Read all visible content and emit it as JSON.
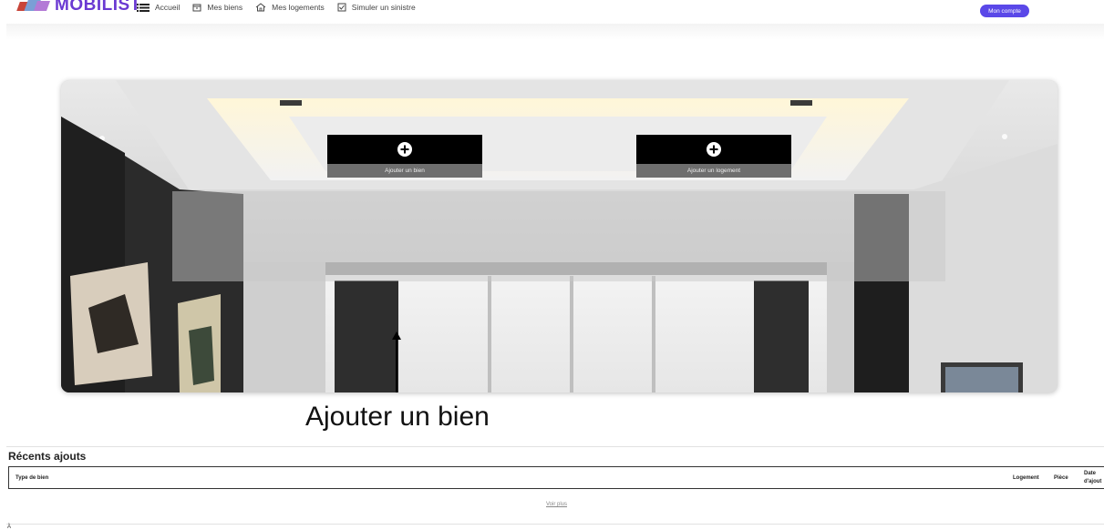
{
  "header": {
    "brand": "MOBILIST",
    "nav": [
      {
        "label": "Accueil",
        "icon": "list-icon"
      },
      {
        "label": "Mes biens",
        "icon": "box-icon"
      },
      {
        "label": "Mes logements",
        "icon": "house-icon"
      },
      {
        "label": "Simuler un sinistre",
        "icon": "checkbox-icon"
      }
    ],
    "account_button": "Mon compte"
  },
  "hero": {
    "actions": [
      {
        "label": "Ajouter un bien",
        "icon": "plus-circle-icon"
      },
      {
        "label": "Ajouter un logement",
        "icon": "plus-circle-icon"
      }
    ]
  },
  "annotation": {
    "caption": "Ajouter un bien"
  },
  "recent": {
    "title": "Récents ajouts",
    "columns": [
      "Type de bien",
      "Logement",
      "Pièce",
      "Date",
      "d'ajout"
    ],
    "see_more": "Voir plus"
  },
  "footer": {
    "mark": "À"
  },
  "colors": {
    "brand": "#6a39d2",
    "account_button": "#5a48e8",
    "action_icon_bg": "#000000",
    "action_label_bg": "#6e6e6e"
  }
}
